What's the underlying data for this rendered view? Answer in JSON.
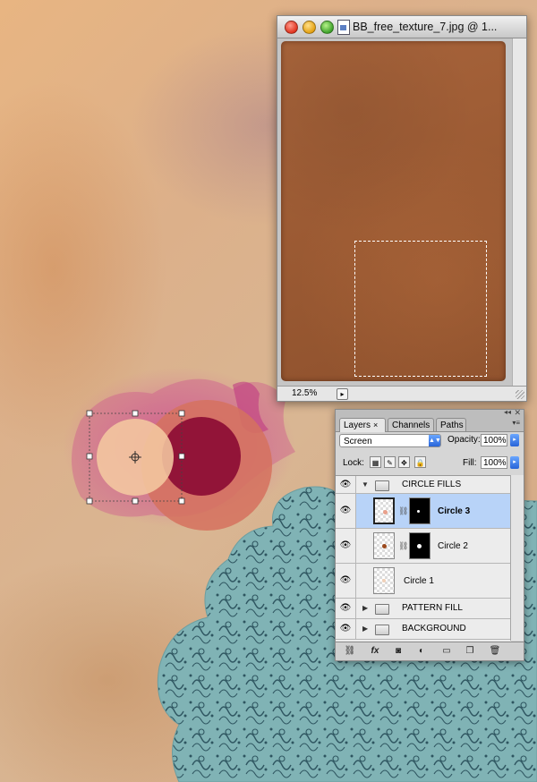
{
  "document_window": {
    "title": "BB_free_texture_7.jpg @ 1...",
    "zoom": "12.5%"
  },
  "layers_panel": {
    "tabs": [
      {
        "label": "Layers",
        "close": "×"
      },
      {
        "label": "Channels"
      },
      {
        "label": "Paths"
      }
    ],
    "blend_mode": "Screen",
    "opacity_label": "Opacity:",
    "opacity_value": "100%",
    "lock_label": "Lock:",
    "fill_label": "Fill:",
    "fill_value": "100%",
    "layers": [
      {
        "name": "CIRCLE FILLS",
        "type": "group",
        "expanded": true
      },
      {
        "name": "Circle 3",
        "type": "layer",
        "selected": true,
        "has_mask": true
      },
      {
        "name": "Circle 2",
        "type": "layer",
        "has_mask": true
      },
      {
        "name": "Circle 1",
        "type": "layer"
      },
      {
        "name": "PATTERN FILL",
        "type": "group",
        "expanded": false
      },
      {
        "name": "BACKGROUND",
        "type": "group",
        "expanded": false
      }
    ],
    "footer_buttons": [
      "link-layers",
      "fx",
      "add-mask",
      "adjustment",
      "new-group",
      "new-layer",
      "delete"
    ]
  },
  "colors": {
    "selection_highlight": "#b8d3f8",
    "teal_shape": "#7fb1b3",
    "circle_dark": "#8e0f36",
    "circle_light": "#f4c8a0",
    "texture": "#9b5a33"
  }
}
